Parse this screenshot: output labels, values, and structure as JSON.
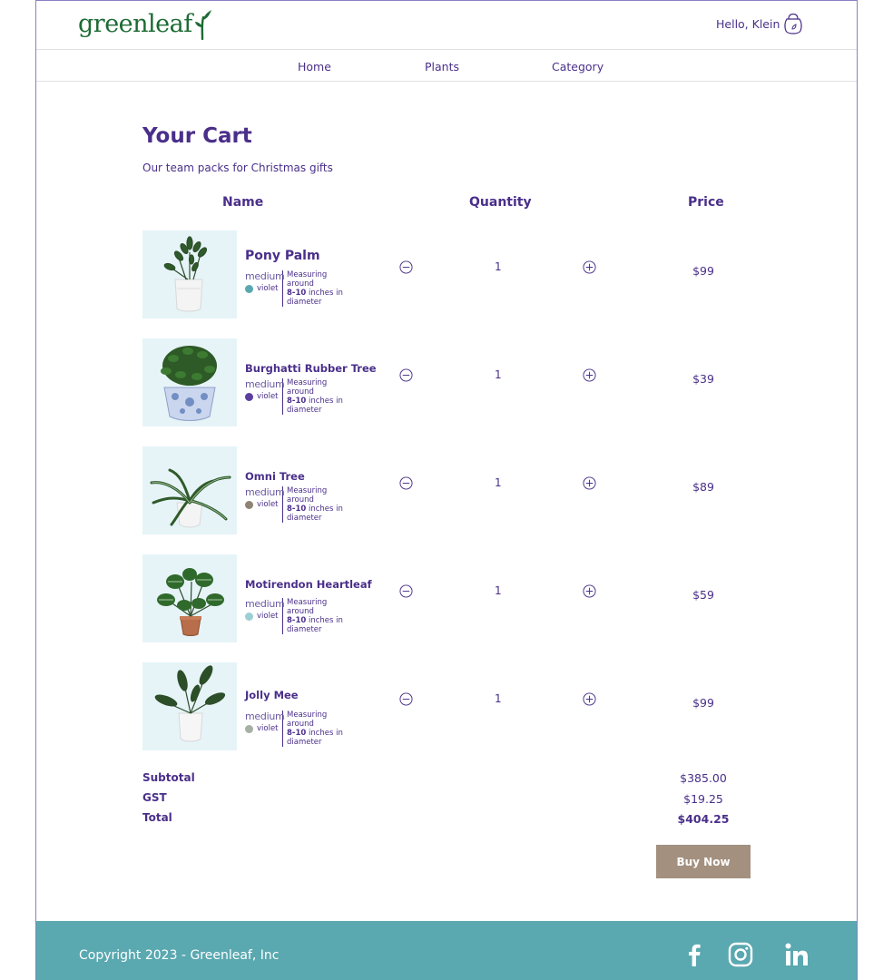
{
  "header": {
    "logo_text": "greenleaf",
    "greeting": "Hello, Klein"
  },
  "nav": {
    "items": [
      {
        "label": "Home"
      },
      {
        "label": "Plants"
      },
      {
        "label": "Category"
      }
    ]
  },
  "cart": {
    "title": "Your Cart",
    "subtitle": "Our team packs for Christmas gifts",
    "columns": {
      "name": "Name",
      "quantity": "Quantity",
      "price": "Price"
    },
    "items": [
      {
        "name": "Pony Palm",
        "size": "medium",
        "color": "violet",
        "dot_color": "#5aa8b0",
        "measure_1": "Measuring around",
        "measure_bold": "8-10",
        "measure_2": " inches in",
        "measure_3": "diameter",
        "quantity": "1",
        "price": "$99"
      },
      {
        "name": "Burghatti Rubber Tree",
        "size": "medium",
        "color": "violet",
        "dot_color": "#5b3fa0",
        "measure_1": "Measuring around",
        "measure_bold": "8-10",
        "measure_2": " inches in",
        "measure_3": "diameter",
        "quantity": "1",
        "price": "$39"
      },
      {
        "name": "Omni Tree",
        "size": "medium",
        "color": "violet",
        "dot_color": "#8f8474",
        "measure_1": "Measuring around",
        "measure_bold": "8-10",
        "measure_2": " inches in",
        "measure_3": "diameter",
        "quantity": "1",
        "price": "$89"
      },
      {
        "name": "Motirendon Heartleaf",
        "size": "medium",
        "color": "violet",
        "dot_color": "#9ccfd3",
        "measure_1": "Measuring around",
        "measure_bold": "8-10",
        "measure_2": " inches in",
        "measure_3": "diameter",
        "quantity": "1",
        "price": "$59"
      },
      {
        "name": "Jolly Mee",
        "size": "medium",
        "color": "violet",
        "dot_color": "#a6b0a4",
        "measure_1": "Measuring around",
        "measure_bold": "8-10",
        "measure_2": " inches in",
        "measure_3": "diameter",
        "quantity": "1",
        "price": "$99"
      }
    ],
    "summary": {
      "subtotal_label": "Subtotal",
      "subtotal": "$385.00",
      "gst_label": "GST",
      "gst": "$19.25",
      "total_label": "Total",
      "total": "$404.25"
    },
    "buy_label": "Buy Now"
  },
  "footer": {
    "copyright": "Copyright 2023 - Greenleaf, Inc"
  },
  "icons": {
    "bag": "shopping-bag-icon",
    "minus": "minus-circle-icon",
    "plus": "plus-circle-icon",
    "facebook": "facebook-icon",
    "instagram": "instagram-icon",
    "linkedin": "linkedin-icon"
  },
  "colors": {
    "brand_purple": "#4a2f8a",
    "logo_green": "#1d6b34",
    "footer_teal": "#5aa8b0",
    "buy_button": "#a3907f",
    "thumb_bg": "#e6f4f8"
  }
}
